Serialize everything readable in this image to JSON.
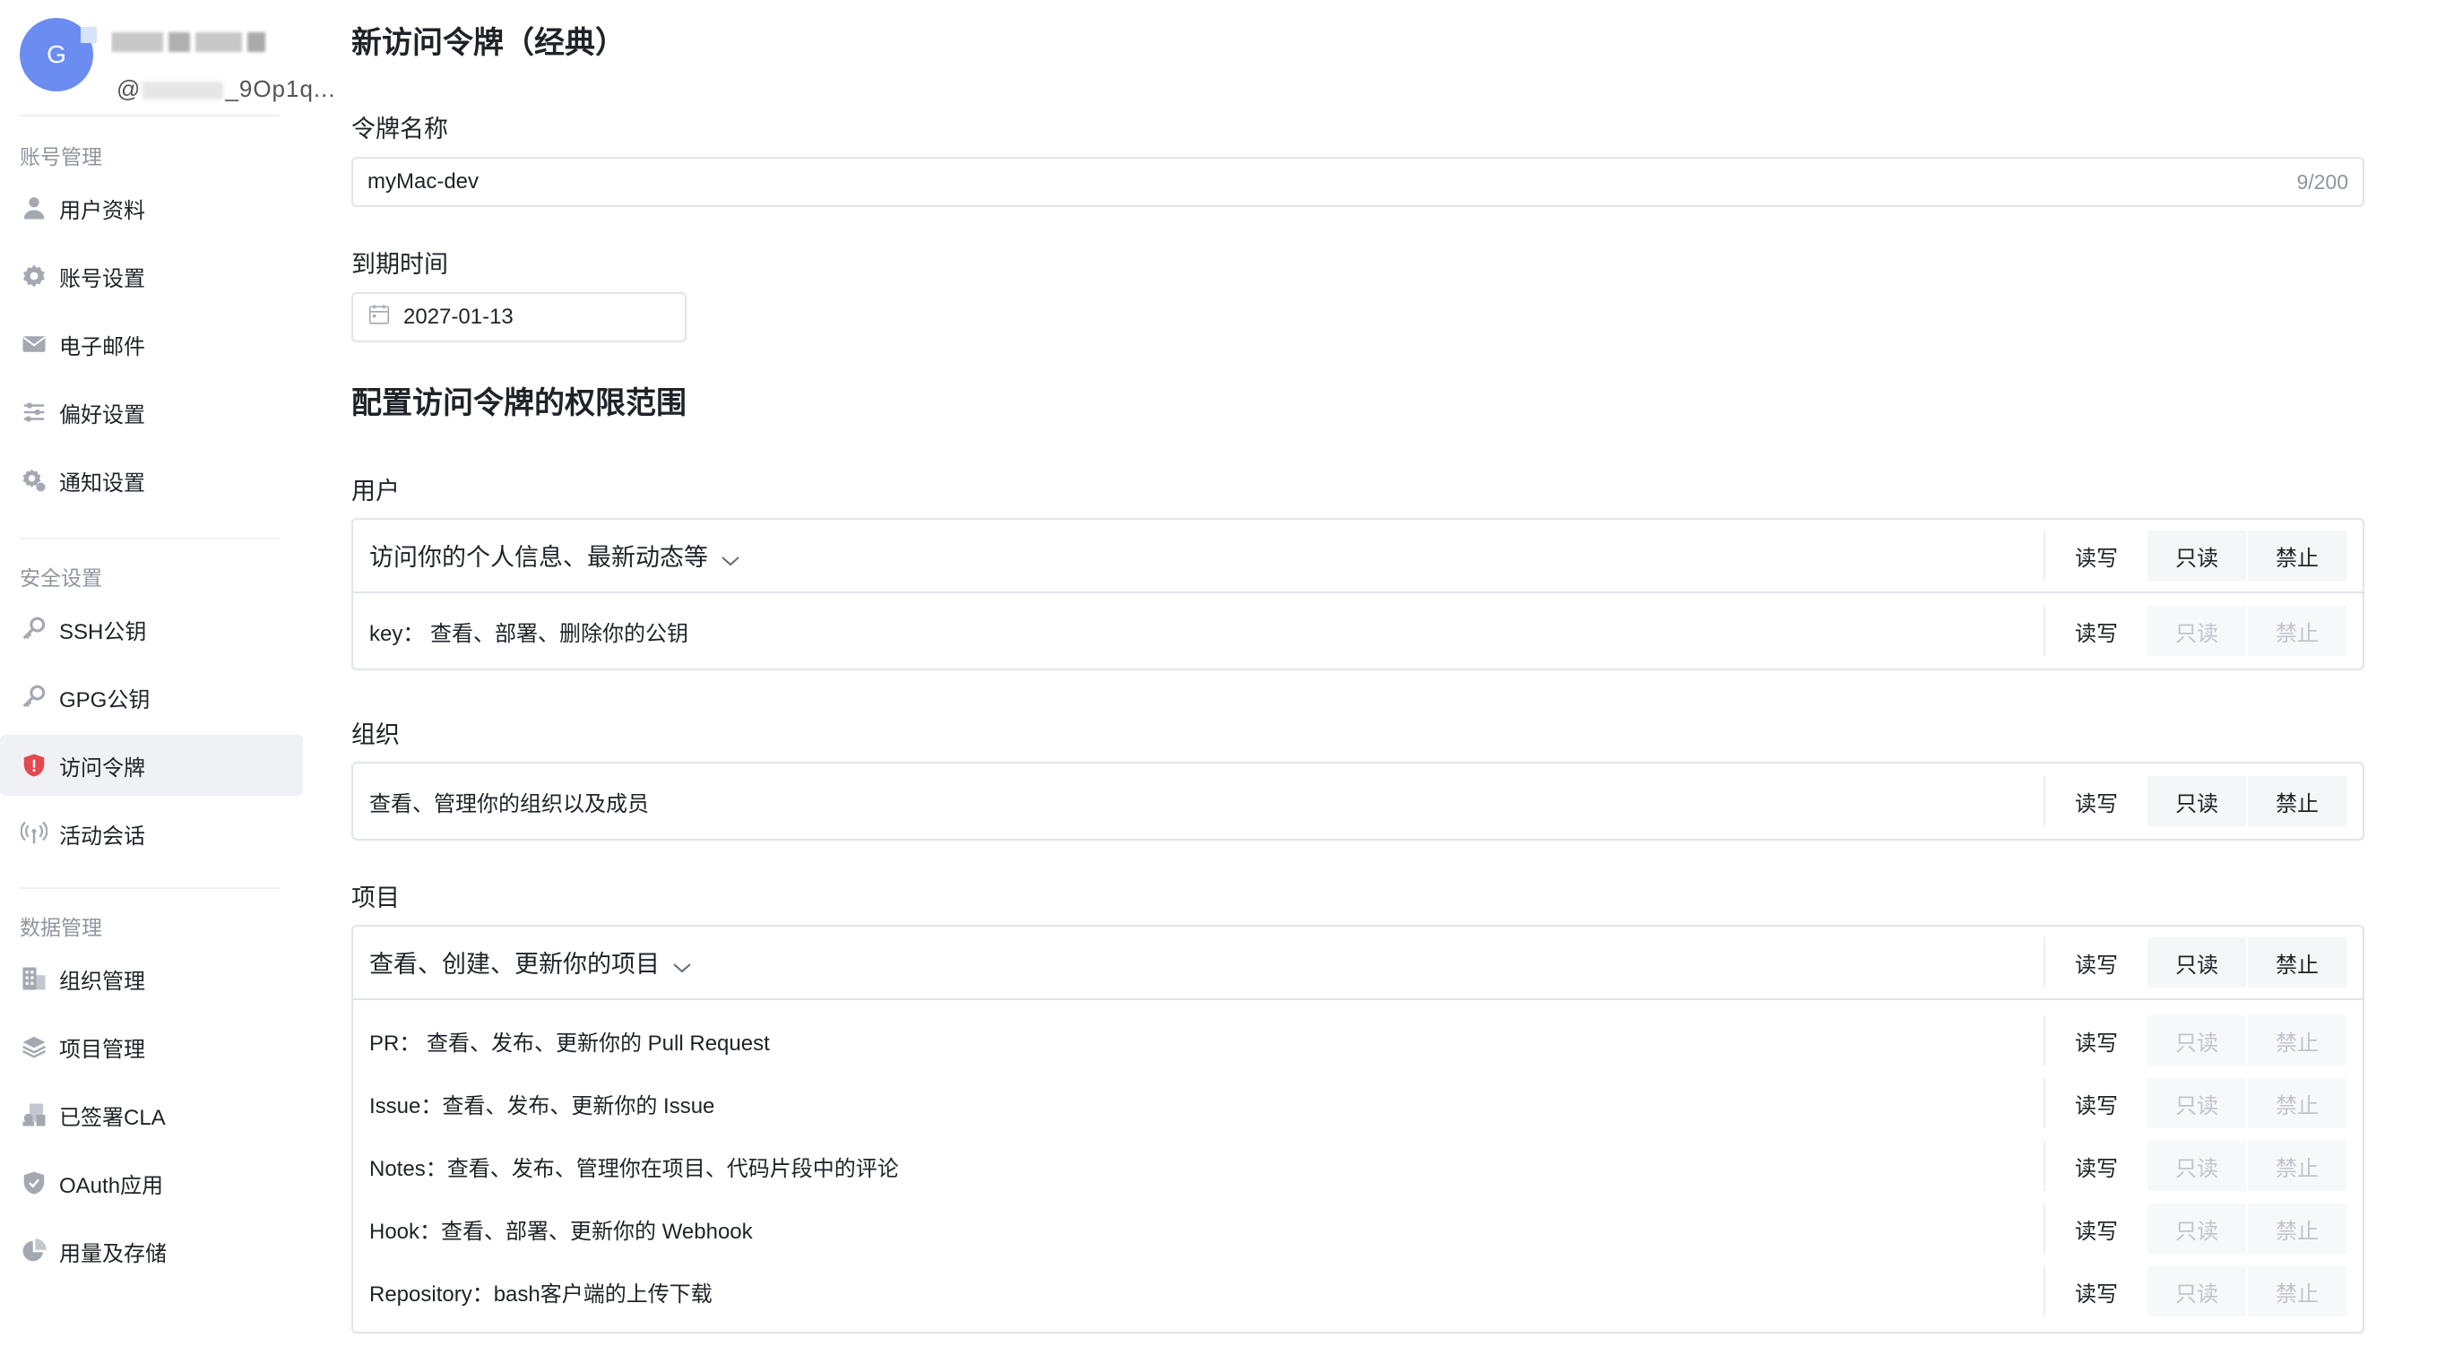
{
  "profile": {
    "avatar_letter": "G",
    "handle_prefix": "@",
    "handle_suffix": "_9Op1q..."
  },
  "sidebar": {
    "groups": [
      {
        "title": "账号管理",
        "items": [
          {
            "label": "用户资料",
            "icon": "user-icon"
          },
          {
            "label": "账号设置",
            "icon": "gear-icon"
          },
          {
            "label": "电子邮件",
            "icon": "mail-icon"
          },
          {
            "label": "偏好设置",
            "icon": "sliders-icon"
          },
          {
            "label": "通知设置",
            "icon": "bell-gear-icon"
          }
        ]
      },
      {
        "title": "安全设置",
        "items": [
          {
            "label": "SSH公钥",
            "icon": "key-icon"
          },
          {
            "label": "GPG公钥",
            "icon": "key-icon"
          },
          {
            "label": "访问令牌",
            "icon": "shield-icon",
            "active": true
          },
          {
            "label": "活动会话",
            "icon": "broadcast-icon"
          }
        ]
      },
      {
        "title": "数据管理",
        "items": [
          {
            "label": "组织管理",
            "icon": "building-icon"
          },
          {
            "label": "项目管理",
            "icon": "layers-icon"
          },
          {
            "label": "已签署CLA",
            "icon": "document-sign-icon"
          },
          {
            "label": "OAuth应用",
            "icon": "shield-check-icon"
          },
          {
            "label": "用量及存储",
            "icon": "pie-chart-icon"
          }
        ]
      }
    ]
  },
  "main": {
    "title": "新访问令牌（经典）",
    "token_name": {
      "label": "令牌名称",
      "value": "myMac-dev",
      "counter": "9/200"
    },
    "expiry": {
      "label": "到期时间",
      "value": "2027-01-13"
    },
    "scope_title": "配置访问令牌的权限范围",
    "options": {
      "rw": "读写",
      "ro": "只读",
      "deny": "禁止"
    },
    "groups": {
      "user": {
        "label": "用户",
        "head": "访问你的个人信息、最新动态等",
        "subs": [
          "key：  查看、部署、删除你的公钥"
        ]
      },
      "org": {
        "label": "组织",
        "head": "查看、管理你的组织以及成员"
      },
      "project": {
        "label": "项目",
        "head": "查看、创建、更新你的项目",
        "subs": [
          "PR：  查看、发布、更新你的 Pull Request",
          "Issue：查看、发布、更新你的 Issue",
          "Notes：查看、发布、管理你在项目、代码片段中的评论",
          "Hook：查看、部署、更新你的 Webhook",
          "Repository：bash客户端的上传下载"
        ]
      }
    }
  }
}
